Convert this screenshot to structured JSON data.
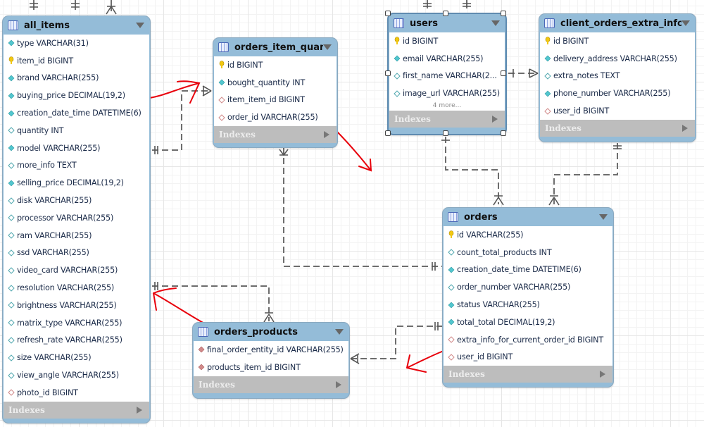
{
  "diagram": {
    "tables": [
      {
        "id": "all_items",
        "name": "all_items",
        "columns": [
          {
            "icon": "attribute-notnull-icon",
            "text": "type VARCHAR(31)"
          },
          {
            "icon": "primary-key-icon",
            "text": "item_id BIGINT"
          },
          {
            "icon": "attribute-notnull-icon",
            "text": "brand VARCHAR(255)"
          },
          {
            "icon": "attribute-notnull-icon",
            "text": "buying_price DECIMAL(19,2)"
          },
          {
            "icon": "attribute-notnull-icon",
            "text": "creation_date_time DATETIME(6)"
          },
          {
            "icon": "attribute-nullable-icon",
            "text": "quantity INT"
          },
          {
            "icon": "attribute-notnull-icon",
            "text": "model VARCHAR(255)"
          },
          {
            "icon": "attribute-nullable-icon",
            "text": "more_info TEXT"
          },
          {
            "icon": "attribute-notnull-icon",
            "text": "selling_price DECIMAL(19,2)"
          },
          {
            "icon": "attribute-nullable-icon",
            "text": "disk VARCHAR(255)"
          },
          {
            "icon": "attribute-nullable-icon",
            "text": "processor VARCHAR(255)"
          },
          {
            "icon": "attribute-nullable-icon",
            "text": "ram VARCHAR(255)"
          },
          {
            "icon": "attribute-nullable-icon",
            "text": "ssd VARCHAR(255)"
          },
          {
            "icon": "attribute-nullable-icon",
            "text": "video_card VARCHAR(255)"
          },
          {
            "icon": "attribute-nullable-icon",
            "text": "resolution VARCHAR(255)"
          },
          {
            "icon": "attribute-nullable-icon",
            "text": "brightness VARCHAR(255)"
          },
          {
            "icon": "attribute-nullable-icon",
            "text": "matrix_type VARCHAR(255)"
          },
          {
            "icon": "attribute-nullable-icon",
            "text": "refresh_rate VARCHAR(255)"
          },
          {
            "icon": "attribute-nullable-icon",
            "text": "size VARCHAR(255)"
          },
          {
            "icon": "attribute-nullable-icon",
            "text": "view_angle VARCHAR(255)"
          },
          {
            "icon": "foreign-key-nullable-icon",
            "text": "photo_id BIGINT"
          }
        ],
        "indexes_label": "Indexes"
      },
      {
        "id": "orders_item_quantity",
        "name": "orders_item_quantity",
        "columns": [
          {
            "icon": "primary-key-icon",
            "text": "id BIGINT"
          },
          {
            "icon": "attribute-notnull-icon",
            "text": "bought_quantity INT"
          },
          {
            "icon": "foreign-key-nullable-icon",
            "text": "item_item_id BIGINT"
          },
          {
            "icon": "foreign-key-nullable-icon",
            "text": "order_id VARCHAR(255)"
          }
        ],
        "indexes_label": "Indexes"
      },
      {
        "id": "users",
        "name": "users",
        "selected": true,
        "columns": [
          {
            "icon": "primary-key-icon",
            "text": "id BIGINT"
          },
          {
            "icon": "attribute-notnull-icon",
            "text": "email VARCHAR(255)"
          },
          {
            "icon": "attribute-nullable-icon",
            "text": "first_name VARCHAR(2..."
          },
          {
            "icon": "attribute-nullable-icon",
            "text": "image_url VARCHAR(255)"
          }
        ],
        "more_label": "4 more...",
        "indexes_label": "Indexes"
      },
      {
        "id": "client_orders_extra_info",
        "name": "client_orders_extra_info",
        "columns": [
          {
            "icon": "primary-key-icon",
            "text": "id BIGINT"
          },
          {
            "icon": "attribute-notnull-icon",
            "text": "delivery_address VARCHAR(255)"
          },
          {
            "icon": "attribute-nullable-icon",
            "text": "extra_notes TEXT"
          },
          {
            "icon": "attribute-notnull-icon",
            "text": "phone_number VARCHAR(255)"
          },
          {
            "icon": "foreign-key-nullable-icon",
            "text": "user_id BIGINT"
          }
        ],
        "indexes_label": "Indexes"
      },
      {
        "id": "orders",
        "name": "orders",
        "columns": [
          {
            "icon": "primary-key-icon",
            "text": "id VARCHAR(255)"
          },
          {
            "icon": "attribute-nullable-icon",
            "text": "count_total_products INT"
          },
          {
            "icon": "attribute-notnull-icon",
            "text": "creation_date_time DATETIME(6)"
          },
          {
            "icon": "attribute-nullable-icon",
            "text": "order_number VARCHAR(255)"
          },
          {
            "icon": "attribute-notnull-icon",
            "text": "status VARCHAR(255)"
          },
          {
            "icon": "attribute-notnull-icon",
            "text": "total_total DECIMAL(19,2)"
          },
          {
            "icon": "foreign-key-nullable-icon",
            "text": "extra_info_for_current_order_id BIGINT"
          },
          {
            "icon": "foreign-key-nullable-icon",
            "text": "user_id BIGINT"
          }
        ],
        "indexes_label": "Indexes"
      },
      {
        "id": "orders_products",
        "name": "orders_products",
        "columns": [
          {
            "icon": "foreign-key-notnull-icon",
            "text": "final_order_entity_id VARCHAR(255)"
          },
          {
            "icon": "foreign-key-notnull-icon",
            "text": "products_item_id BIGINT"
          }
        ],
        "indexes_label": "Indexes"
      }
    ],
    "relationships": [
      {
        "from": "all_items",
        "to": "orders_item_quantity",
        "type": "one-to-many"
      },
      {
        "from": "orders",
        "to": "orders_item_quantity",
        "type": "one-to-many"
      },
      {
        "from": "all_items",
        "to": "orders_products",
        "type": "one-to-many"
      },
      {
        "from": "orders",
        "to": "orders_products",
        "type": "one-to-many"
      },
      {
        "from": "users",
        "to": "orders",
        "type": "one-to-many"
      },
      {
        "from": "users",
        "to": "client_orders_extra_info",
        "type": "one-to-many"
      },
      {
        "from": "client_orders_extra_info",
        "to": "orders",
        "type": "one-to-many"
      }
    ],
    "annotation_color": "#e8000b",
    "colors": {
      "header": "#94bcd8",
      "indexes_bar": "#bdbdbd",
      "primary_key": "#f2c811",
      "attribute_notnull": "#52c7cf",
      "foreign_key": "#d18a8a",
      "relationship_line": "#6d6d6d"
    }
  }
}
